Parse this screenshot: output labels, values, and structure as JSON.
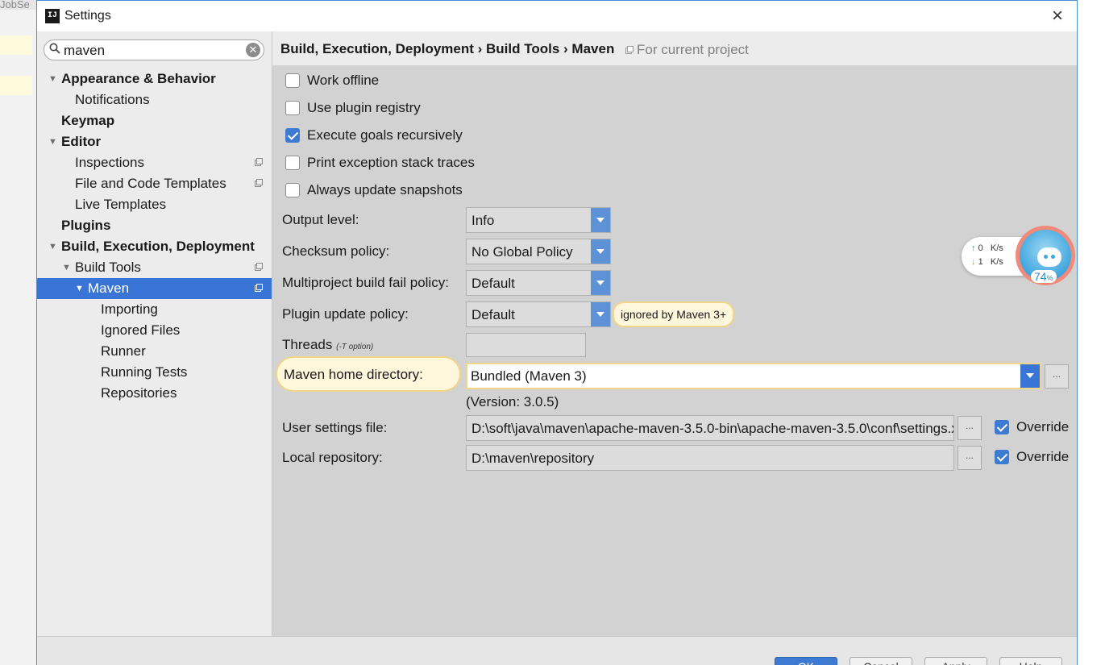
{
  "background": {
    "tab_text": "JobSe"
  },
  "window": {
    "title": "Settings",
    "app_icon": "IJ",
    "close_glyph": "×"
  },
  "search": {
    "value": "maven"
  },
  "tree": [
    {
      "label": "Appearance & Behavior",
      "bold": true,
      "expanded": true,
      "level": 0
    },
    {
      "label": "Notifications",
      "bold": false,
      "level": 1
    },
    {
      "label": "Keymap",
      "bold": true,
      "level": 0
    },
    {
      "label": "Editor",
      "bold": true,
      "expanded": true,
      "level": 0
    },
    {
      "label": "Inspections",
      "bold": false,
      "level": 1,
      "project_icon": true
    },
    {
      "label": "File and Code Templates",
      "bold": false,
      "level": 1,
      "project_icon": true
    },
    {
      "label": "Live Templates",
      "bold": false,
      "level": 1
    },
    {
      "label": "Plugins",
      "bold": true,
      "level": 0
    },
    {
      "label": "Build, Execution, Deployment",
      "bold": true,
      "expanded": true,
      "level": 0
    },
    {
      "label": "Build Tools",
      "bold": false,
      "expanded": true,
      "level": 1,
      "project_icon": true
    },
    {
      "label": "Maven",
      "bold": false,
      "expanded": true,
      "level": 2,
      "project_icon": true,
      "selected": true
    },
    {
      "label": "Importing",
      "bold": false,
      "level": 3
    },
    {
      "label": "Ignored Files",
      "bold": false,
      "level": 3
    },
    {
      "label": "Runner",
      "bold": false,
      "level": 3
    },
    {
      "label": "Running Tests",
      "bold": false,
      "level": 3
    },
    {
      "label": "Repositories",
      "bold": false,
      "level": 3
    }
  ],
  "breadcrumb": {
    "path": "Build, Execution, Deployment › Build Tools › Maven",
    "scope": "For current project"
  },
  "checkboxes": [
    {
      "label": "Work offline",
      "checked": false
    },
    {
      "label": "Use plugin registry",
      "checked": false
    },
    {
      "label": "Execute goals recursively",
      "checked": true
    },
    {
      "label": "Print exception stack traces",
      "checked": false
    },
    {
      "label": "Always update snapshots",
      "checked": false
    }
  ],
  "fields": {
    "output_level": {
      "label": "Output level:",
      "value": "Info"
    },
    "checksum_policy": {
      "label": "Checksum policy:",
      "value": "No Global Policy"
    },
    "multiproject_fail": {
      "label": "Multiproject build fail policy:",
      "value": "Default"
    },
    "plugin_update": {
      "label": "Plugin update policy:",
      "value": "Default",
      "hint": "ignored by Maven 3+"
    },
    "threads": {
      "label": "Threads",
      "hint": "(-T option)",
      "value": ""
    },
    "maven_home": {
      "label": "Maven home directory:",
      "value": "Bundled (Maven 3)",
      "version": "(Version: 3.0.5)"
    },
    "user_settings": {
      "label": "User settings file:",
      "value": "D:\\soft\\java\\maven\\apache-maven-3.5.0-bin\\apache-maven-3.5.0\\conf\\settings.xml",
      "override_label": "Override",
      "override": true
    },
    "local_repo": {
      "label": "Local repository:",
      "value": "D:\\maven\\repository",
      "override_label": "Override",
      "override": true
    },
    "browse_label": "..."
  },
  "net_widget": {
    "up_value": "0",
    "up_unit": "K/s",
    "down_value": "1",
    "down_unit": "K/s",
    "percent": "74",
    "percent_sign": "%"
  },
  "buttons": {
    "ok": "OK",
    "cancel": "Cancel",
    "apply": "Apply",
    "help": "Help"
  },
  "colors": {
    "accent": "#3875d7",
    "highlight": "#fff7dc",
    "highlight_border": "#f1d68a"
  }
}
